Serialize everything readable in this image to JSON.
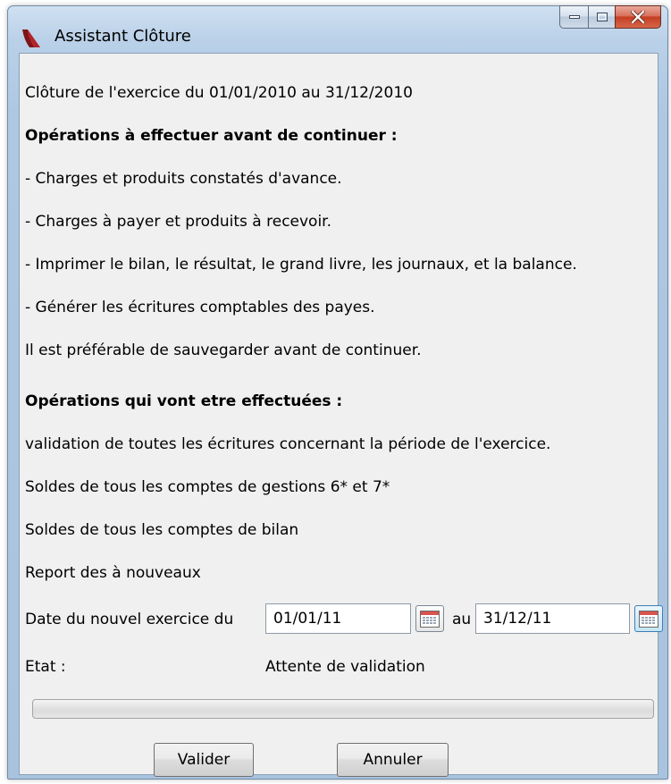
{
  "window": {
    "title": "Assistant Clôture"
  },
  "content": {
    "exercise_line": "Clôture de l'exercice du 01/01/2010 au 31/12/2010",
    "before_heading": "Opérations à effectuer avant de continuer :",
    "before_items": [
      "- Charges et produits constatés d'avance.",
      "- Charges à payer et produits à recevoir.",
      "- Imprimer le bilan, le résultat, le grand livre, les journaux, et la balance.",
      "- Générer les écritures comptables des payes."
    ],
    "save_advice": "Il est préférable de sauvegarder avant de continuer.",
    "after_heading": "Opérations qui vont etre effectuées :",
    "after_items": [
      "validation de toutes les écritures concernant la période de l'exercice.",
      "Soldes de tous les comptes de gestions 6* et 7*",
      "Soldes de tous les comptes de bilan",
      "Report des à nouveaux"
    ]
  },
  "new_exercise": {
    "label": "Date du nouvel exercice du",
    "start_value": "01/01/11",
    "separator": "au",
    "end_value": "31/12/11"
  },
  "status": {
    "label": "Etat :",
    "value": "Attente de validation"
  },
  "progress": {
    "fraction": 0
  },
  "buttons": {
    "validate": "Valider",
    "cancel": "Annuler"
  },
  "icons": {
    "app": "app-logo-icon",
    "minimize": "minimize-icon",
    "maximize": "maximize-icon",
    "close": "close-icon",
    "calendar": "calendar-icon"
  },
  "colors": {
    "close_button": "#c43e22",
    "calendar_header": "#d9534f",
    "progress_fill": "#06b025"
  }
}
